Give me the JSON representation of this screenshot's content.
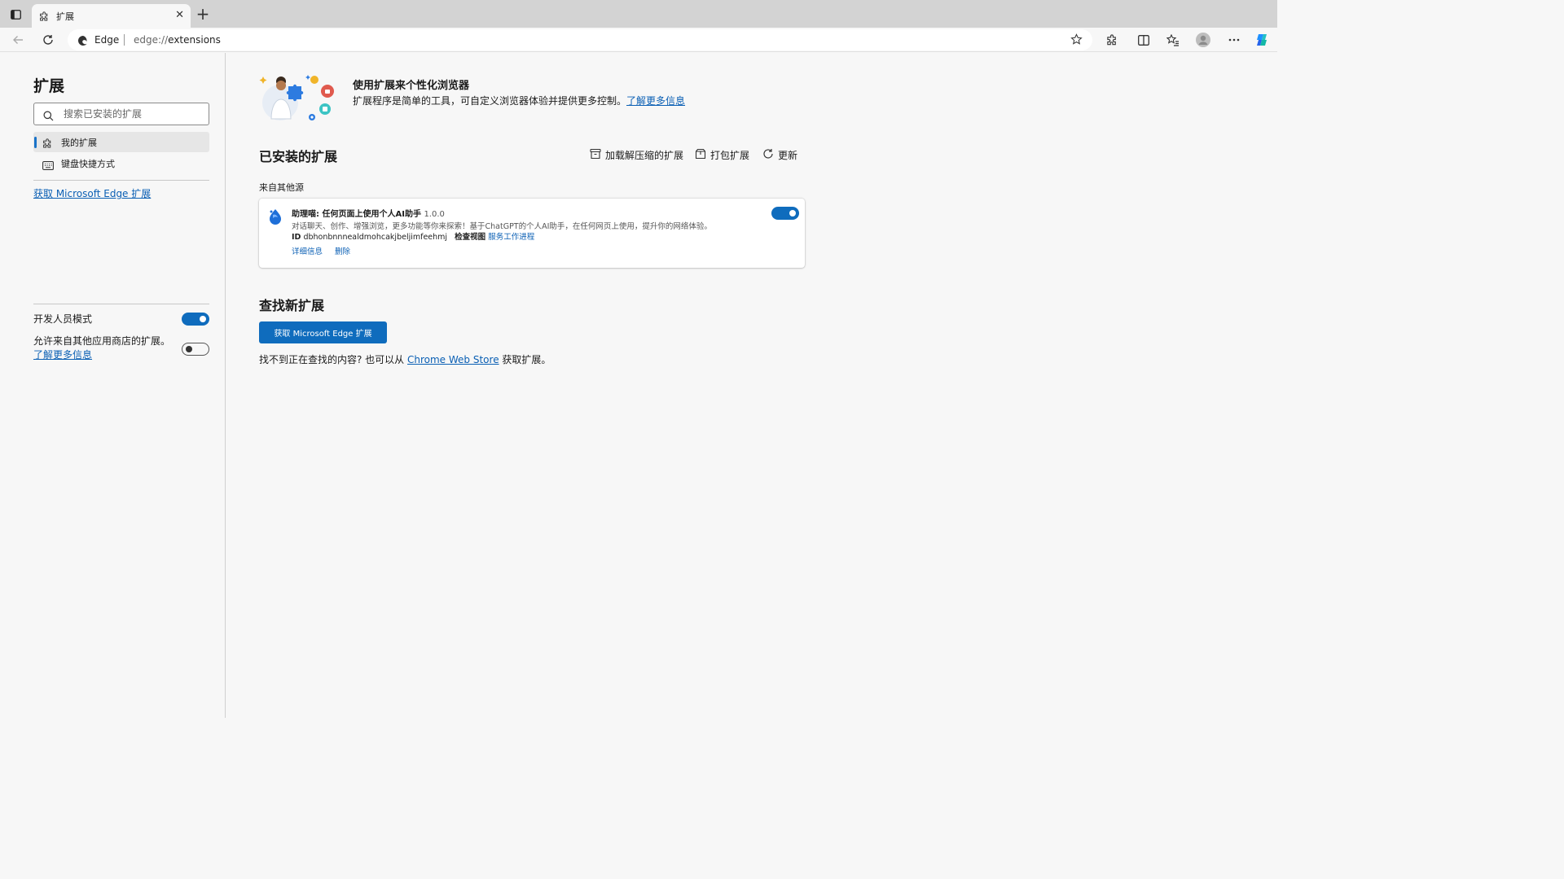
{
  "tab": {
    "title": "扩展"
  },
  "address": {
    "site": "Edge",
    "url_scheme": "edge://",
    "url_path": "extensions"
  },
  "sidebar": {
    "title": "扩展",
    "search_placeholder": "搜索已安装的扩展",
    "items": [
      {
        "label": "我的扩展",
        "active": true
      },
      {
        "label": "键盘快捷方式",
        "active": false
      }
    ],
    "get_extensions_link": "获取 Microsoft Edge 扩展",
    "developer_mode_label": "开发人员模式",
    "developer_mode_on": true,
    "allow_other_stores_text": "允许来自其他应用商店的扩展。",
    "allow_other_stores_link": "了解更多信息",
    "allow_other_stores_on": false
  },
  "hero": {
    "title": "使用扩展来个性化浏览器",
    "desc": "扩展程序是简单的工具，可自定义浏览器体验并提供更多控制。",
    "learn_more": "了解更多信息"
  },
  "installed": {
    "title": "已安装的扩展",
    "actions": {
      "load_unpacked": "加载解压缩的扩展",
      "pack": "打包扩展",
      "update": "更新"
    },
    "source_label": "来自其他源",
    "extension": {
      "name": "助理喵: 任何页面上使用个人AI助手",
      "version": "1.0.0",
      "description": "对话聊天、创作、增强浏览，更多功能等你来探索！基于ChatGPT的个人AI助手，在任何网页上使用，提升你的网络体验。",
      "id_label": "ID",
      "id": "dbhonbnnnealdmohcakjbeljimfeehmj",
      "inspect_label": "检查视图",
      "service_worker": "服务工作进程",
      "details": "详细信息",
      "remove": "删除",
      "enabled": true
    }
  },
  "find": {
    "title": "查找新扩展",
    "button": "获取 Microsoft Edge 扩展",
    "text_before": "找不到正在查找的内容? 也可以从 ",
    "store_link": "Chrome Web Store",
    "text_after": " 获取扩展。"
  },
  "colors": {
    "accent": "#0f6cbd",
    "link": "#0a5fb4"
  }
}
